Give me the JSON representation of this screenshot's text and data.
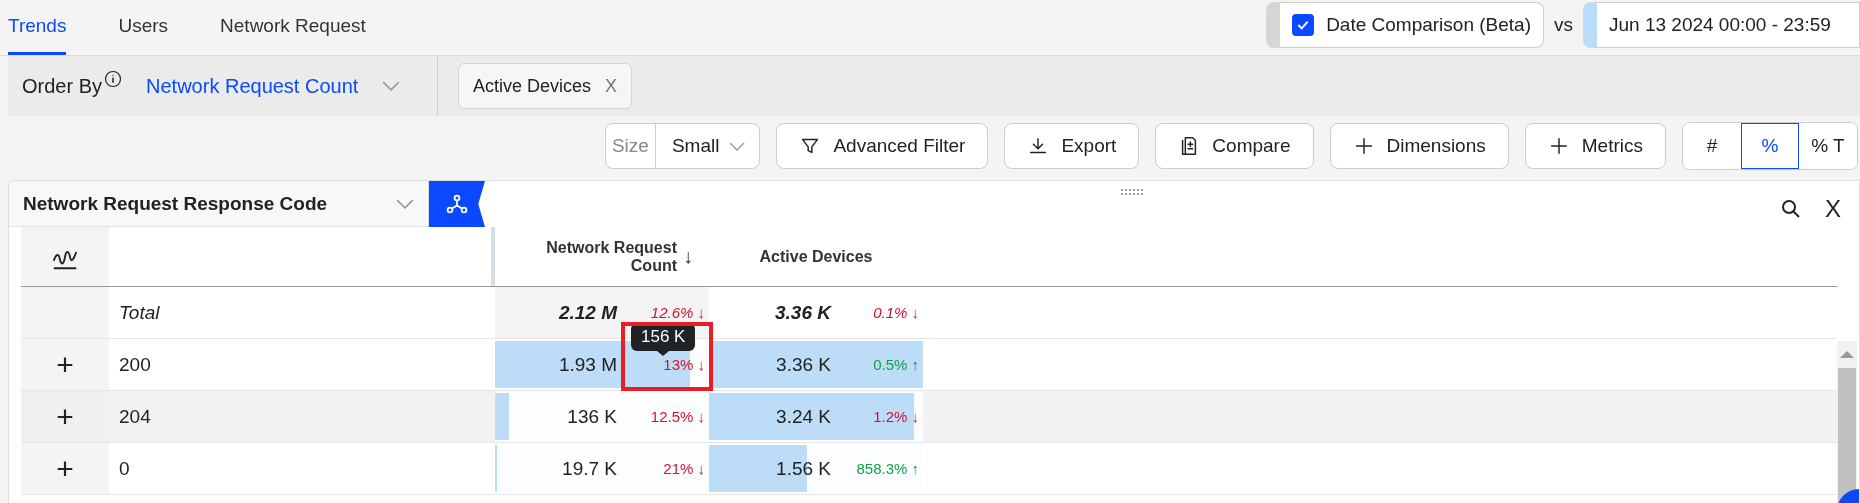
{
  "tabs": [
    {
      "label": "Trends",
      "selected": true
    },
    {
      "label": "Users",
      "selected": false
    },
    {
      "label": "Network Request",
      "selected": false
    }
  ],
  "date_comparison": {
    "label": "Date Comparison (Beta)",
    "checked": true,
    "vs": "vs",
    "range": "Jun 13 2024 00:00 - 23:59"
  },
  "order_by": {
    "label": "Order By",
    "value": "Network Request Count"
  },
  "chips": [
    {
      "label": "Active Devices",
      "close": "X"
    }
  ],
  "toolbar": {
    "size": {
      "label": "Size",
      "value": "Small"
    },
    "buttons": [
      {
        "label": "Advanced Filter"
      },
      {
        "label": "Export"
      },
      {
        "label": "Compare"
      },
      {
        "label": "Dimensions"
      },
      {
        "label": "Metrics"
      }
    ],
    "view_modes": [
      {
        "label": "#",
        "selected": false
      },
      {
        "label": "%",
        "selected": true
      },
      {
        "label": "% T",
        "selected": false
      }
    ]
  },
  "panel": {
    "dimension": "Network Request Response Code",
    "close": "X",
    "columns": [
      {
        "label": "Network Request Count",
        "sort": "↓"
      },
      {
        "label": "Active Devices"
      }
    ],
    "rows": [
      {
        "kind": "total",
        "label": "Total",
        "highlighted": false,
        "metrics": [
          {
            "value": "2.12 M",
            "change": "12.6% ↓",
            "color": "#d8112d"
          },
          {
            "value": "3.36 K",
            "change": "0.1% ↓",
            "color": "#d8112d"
          }
        ]
      },
      {
        "kind": "item",
        "expand": "+",
        "label": "200",
        "highlighted": false,
        "tooltip": "156 K",
        "metrics": [
          {
            "value": "1.93 M",
            "change": "13% ↓",
            "color": "#d8112d",
            "level": 0.91
          },
          {
            "value": "3.36 K",
            "change": "0.5% ↑",
            "color": "#12a04a",
            "level": 1
          }
        ]
      },
      {
        "kind": "item",
        "expand": "+",
        "label": "204",
        "highlighted": true,
        "metrics": [
          {
            "value": "136 K",
            "change": "12.5% ↓",
            "color": "#d8112d",
            "level": 0.064
          },
          {
            "value": "3.24 K",
            "change": "1.2% ↓",
            "color": "#d8112d",
            "level": 0.96
          }
        ]
      },
      {
        "kind": "item",
        "expand": "+",
        "label": "0",
        "highlighted": false,
        "metrics": [
          {
            "value": "19.7 K",
            "change": "21% ↓",
            "color": "#d8112d",
            "level": 0.01
          },
          {
            "value": "1.56 K",
            "change": "858.3% ↑",
            "color": "#12a04a",
            "level": 0.46
          }
        ]
      }
    ]
  }
}
